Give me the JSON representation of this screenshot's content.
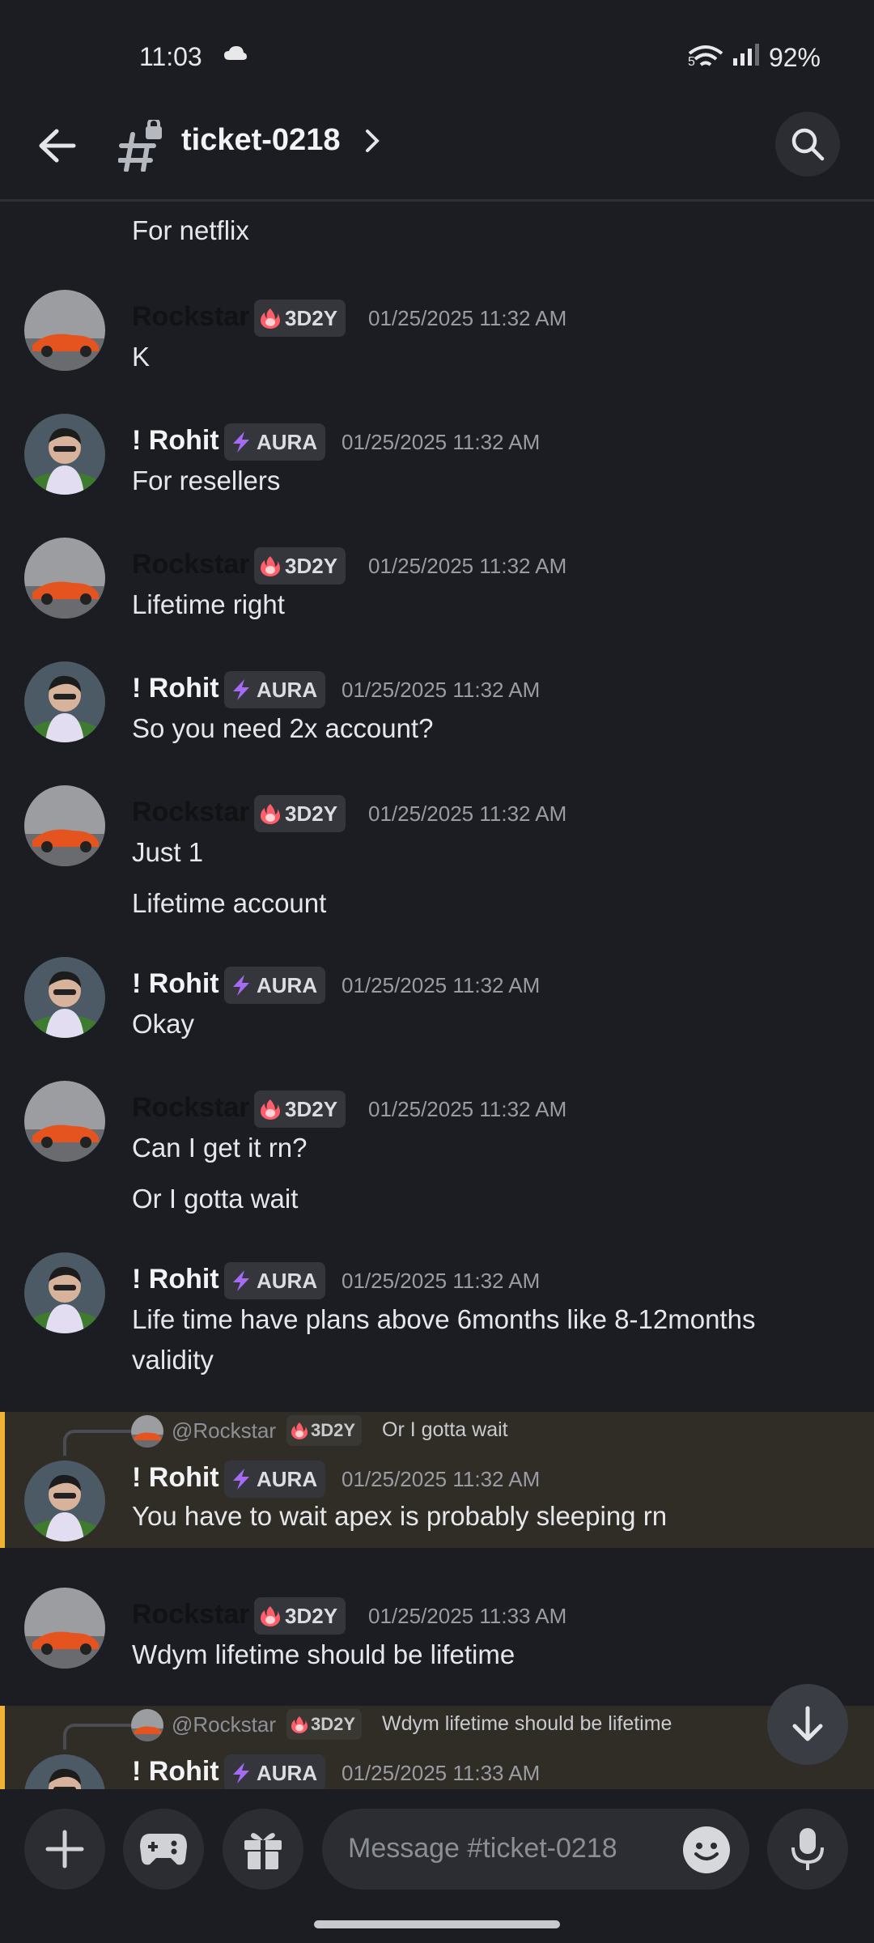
{
  "status": {
    "time": "11:03",
    "battery": "92%",
    "network": "5"
  },
  "header": {
    "channel": "ticket-0218"
  },
  "composer": {
    "placeholder": "Message #ticket-0218"
  },
  "colors": {
    "background": "#1b1d22",
    "highlight": "#302c26",
    "highlight_bar": "#f0b232",
    "tag_bg": "#34363c"
  },
  "users": {
    "rockstar": {
      "name": "Rockstar",
      "tag": "3D2Y",
      "tag_icon": "fire-icon"
    },
    "rohit": {
      "name": "! Rohit",
      "tag": "AURA",
      "tag_icon": "lightning-icon"
    }
  },
  "messages": [
    {
      "cont": "For netflix"
    },
    {
      "author": "rockstar",
      "time": "01/25/2025 11:32 AM",
      "lines": [
        "K"
      ]
    },
    {
      "author": "rohit",
      "time": "01/25/2025 11:32 AM",
      "lines": [
        "For resellers"
      ]
    },
    {
      "author": "rockstar",
      "time": "01/25/2025 11:32 AM",
      "lines": [
        "Lifetime right"
      ]
    },
    {
      "author": "rohit",
      "time": "01/25/2025 11:32 AM",
      "lines": [
        "So you need 2x account?"
      ]
    },
    {
      "author": "rockstar",
      "time": "01/25/2025 11:32 AM",
      "lines": [
        "Just 1",
        "Lifetime account"
      ]
    },
    {
      "author": "rohit",
      "time": "01/25/2025 11:32 AM",
      "lines": [
        "Okay"
      ]
    },
    {
      "author": "rockstar",
      "time": "01/25/2025 11:32 AM",
      "lines": [
        "Can I get it rn?",
        "Or I gotta wait"
      ]
    },
    {
      "author": "rohit",
      "time": "01/25/2025 11:32 AM",
      "lines": [
        "Life time have plans above 6months like 8-12months validity"
      ]
    },
    {
      "author": "rohit",
      "time": "01/25/2025 11:32 AM",
      "lines": [
        "You have to wait apex is probably sleeping rn"
      ],
      "reply": {
        "name": "@Rockstar",
        "tag": "3D2Y",
        "text": "Or I gotta wait"
      }
    },
    {
      "author": "rockstar",
      "time": "01/25/2025 11:33 AM",
      "lines": [
        "Wdym lifetime should be lifetime"
      ]
    },
    {
      "author": "rohit",
      "time": "01/25/2025 11:33 AM",
      "lines": [],
      "reply": {
        "name": "@Rockstar",
        "tag": "3D2Y",
        "text": "Wdym lifetime should be lifetime"
      }
    }
  ]
}
